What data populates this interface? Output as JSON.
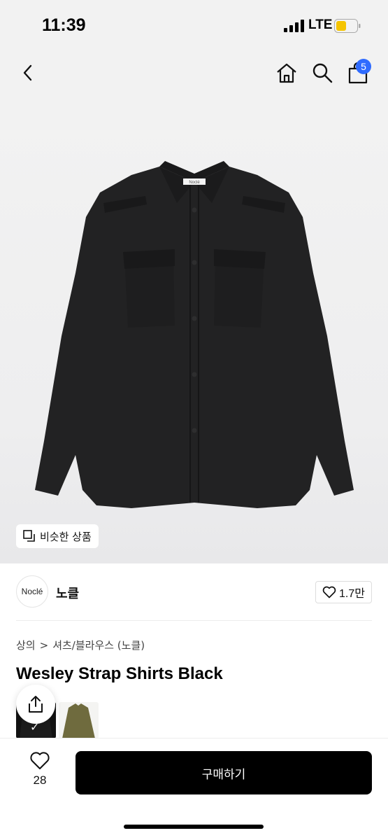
{
  "status": {
    "time": "11:39",
    "network": "LTE",
    "battery_color": "#f5c400"
  },
  "nav": {
    "cart_count": "5",
    "badge_color": "#2f6bff"
  },
  "hero": {
    "shirt_label": "Noclé",
    "similar_label": "비슷한 상품"
  },
  "brand": {
    "logo_text": "Noclé",
    "name": "노클",
    "follow_count": "1.7만"
  },
  "breadcrumb": {
    "category": "상의",
    "separator": ">",
    "subcategory": "셔츠/블라우스 (노클)"
  },
  "product": {
    "title": "Wesley Strap Shirts Black",
    "thumbnails": [
      {
        "icon": "black-shirt-thumbnail",
        "selected": true
      },
      {
        "icon": "olive-shirt-thumbnail",
        "selected": false
      }
    ]
  },
  "bottom": {
    "like_count": "28",
    "buy_label": "구매하기"
  }
}
